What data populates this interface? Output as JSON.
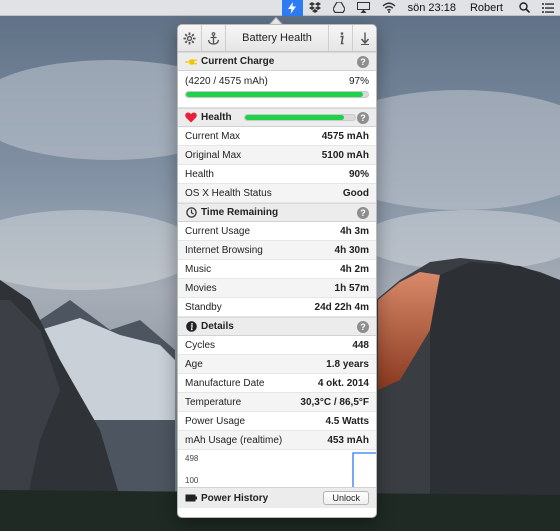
{
  "menubar": {
    "clock": "sön 23:18",
    "user": "Robert",
    "icons": [
      "battery-health-icon",
      "dropbox-icon",
      "google-drive-icon",
      "airplay-icon",
      "wifi-icon",
      "search-icon",
      "list-icon"
    ]
  },
  "toolbar": {
    "title": "Battery Health",
    "icons": [
      "gear-icon",
      "anchor-icon",
      "info-icon",
      "download-icon"
    ]
  },
  "current_charge": {
    "title": "Current Charge",
    "mah_text": "(4220 / 4575 mAh)",
    "percent_text": "97%",
    "fill_fraction": 0.97,
    "help": "?"
  },
  "health": {
    "title": "Health",
    "fill_fraction": 0.9,
    "help": "?",
    "rows": [
      {
        "label": "Current Max",
        "value": "4575 mAh"
      },
      {
        "label": "Original Max",
        "value": "5100 mAh"
      },
      {
        "label": "Health",
        "value": "90%"
      },
      {
        "label": "OS X Health Status",
        "value": "Good"
      }
    ]
  },
  "time_remaining": {
    "title": "Time Remaining",
    "help": "?",
    "rows": [
      {
        "label": "Current Usage",
        "value": "4h 3m"
      },
      {
        "label": "Internet Browsing",
        "value": "4h 30m"
      },
      {
        "label": "Music",
        "value": "4h 2m"
      },
      {
        "label": "Movies",
        "value": "1h 57m"
      },
      {
        "label": "Standby",
        "value": "24d 22h 4m"
      }
    ]
  },
  "details": {
    "title": "Details",
    "help": "?",
    "rows": [
      {
        "label": "Cycles",
        "value": "448"
      },
      {
        "label": "Age",
        "value": "1.8 years"
      },
      {
        "label": "Manufacture Date",
        "value": "4 okt. 2014"
      },
      {
        "label": "Temperature",
        "value": "30,3°C / 86,5°F"
      },
      {
        "label": "Power Usage",
        "value": "4.5 Watts"
      },
      {
        "label": "mAh Usage (realtime)",
        "value": "453 mAh"
      }
    ]
  },
  "graph": {
    "label_max": "498",
    "label_min": "100"
  },
  "footer": {
    "title": "Power History",
    "unlock_label": "Unlock"
  },
  "colors": {
    "accent": "#2d7cf2",
    "bar_green": "#1fd24a",
    "heart_red": "#e8203a",
    "plug_yellow": "#f2c400"
  }
}
